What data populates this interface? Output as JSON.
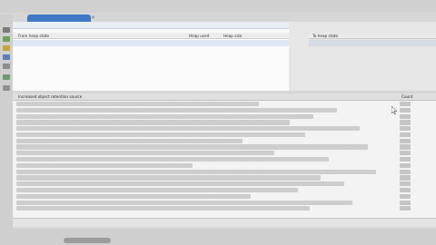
{
  "colors": {
    "accent_tab": "#3f78c6",
    "selection": "#dfe8f5"
  },
  "editor_tab": {
    "label": "",
    "icon": "java-file-icon"
  },
  "heap_view": {
    "title": "",
    "columns": [
      "From heap state",
      "Heap used",
      "Heap size"
    ],
    "rows": [
      {
        "state": "",
        "used": "",
        "size": ""
      },
      {
        "state": "",
        "used": "",
        "size": ""
      }
    ]
  },
  "to_heap_view": {
    "columns": [
      "To heap state"
    ],
    "rows": [
      ""
    ]
  },
  "references_view": {
    "columns": [
      "Increased object retention source",
      "Count"
    ]
  },
  "icons": [
    "back-icon",
    "forward-icon",
    "run-icon",
    "debug-icon",
    "heap-icon",
    "gc-icon",
    "refresh-icon",
    "settings-icon"
  ]
}
